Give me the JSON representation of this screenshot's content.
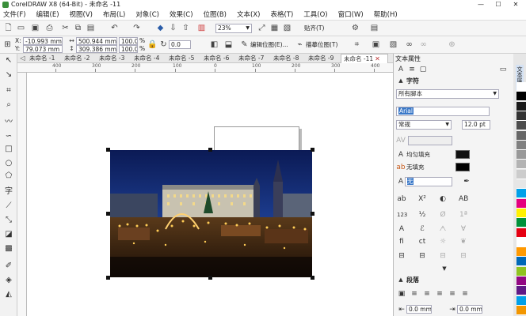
{
  "window": {
    "title": "CorelDRAW X8 (64-Bit) - 未命名 -11",
    "controls": [
      "—",
      "☐",
      "✕"
    ]
  },
  "menu": [
    "文件(F)",
    "编辑(E)",
    "视图(V)",
    "布局(L)",
    "对象(C)",
    "效果(C)",
    "位图(B)",
    "文本(X)",
    "表格(T)",
    "工具(O)",
    "窗口(W)",
    "帮助(H)"
  ],
  "toolbar1": {
    "zoom": "23%",
    "snap_label": "贴齐(T)"
  },
  "property_bar": {
    "x_label": "X:",
    "x": "-10.993 mm",
    "y_label": "Y:",
    "y": "79.073 mm",
    "width": "500.944 mm",
    "height": "309.386 mm",
    "scale_x": "100.0",
    "scale_y": "100.0",
    "percent": "%",
    "rotation": "0.0",
    "edit_bitmap": "编辑位图(E)...",
    "trace_bitmap": "描摹位图(T)"
  },
  "tabs": [
    {
      "label": "未命名 -1"
    },
    {
      "label": "未命名 -2"
    },
    {
      "label": "未命名 -3"
    },
    {
      "label": "未命名 -4"
    },
    {
      "label": "未命名 -5"
    },
    {
      "label": "未命名 -6"
    },
    {
      "label": "未命名 -7"
    },
    {
      "label": "未命名 -8"
    },
    {
      "label": "未命名 -9"
    },
    {
      "label": "未命名 -11",
      "active": true
    }
  ],
  "ruler": {
    "h": [
      "400",
      "300",
      "200",
      "100",
      "0",
      "100",
      "200",
      "300",
      "400",
      "500"
    ]
  },
  "panel": {
    "title": "文本属性",
    "char_header": "字符",
    "script": "所有脚本",
    "font": "Arial",
    "style": "常规",
    "size": "12.0 pt",
    "fill_label": "均匀填充",
    "bg_label": "无填充",
    "outline_label": "无",
    "para_header": "段落",
    "indent_left": "0.0 mm",
    "indent_right": "0.0 mm",
    "vtab": "文本属性"
  },
  "colors": {
    "accent": "#2a5ca8",
    "fill_swatch": "#111111",
    "bg_swatch": "#000000",
    "palette": [
      "#ffffff",
      "#000000",
      "#1a1a1a",
      "#333333",
      "#4d4d4d",
      "#666666",
      "#808080",
      "#999999",
      "#b3b3b3",
      "#cccccc",
      "#e6e6e6",
      "#00a0e9",
      "#e4007f",
      "#fff100",
      "#00913a",
      "#e60012",
      "#ffffff",
      "#ff9900",
      "#0068b7",
      "#8fc31f",
      "#920783",
      "#601986",
      "#00a0e9",
      "#f29600"
    ]
  }
}
